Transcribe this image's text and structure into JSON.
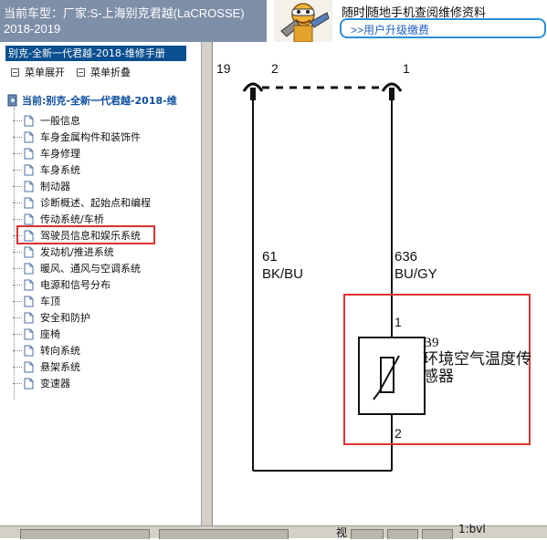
{
  "header": {
    "vehicle_title_line1": "当前车型：厂家:S-上海别克君越(LaCROSSE)",
    "vehicle_title_line2": "2018-2019"
  },
  "banner": {
    "line1_a": "随时",
    "line1_b": "随地手机查阅维修资料",
    "upgrade_link": ">>用户升级缴费"
  },
  "sidebar": {
    "manual_title": "别克-全新一代君越-2018-维修手册",
    "expand_menu": "菜单展开",
    "collapse_menu": "菜单折叠",
    "root_label": "当前:别克-全新一代君越-2018-维",
    "items": [
      {
        "label": "一般信息"
      },
      {
        "label": "车身金属构件和装饰件"
      },
      {
        "label": "车身修理"
      },
      {
        "label": "车身系统"
      },
      {
        "label": "制动器"
      },
      {
        "label": "诊断概述、起始点和编程"
      },
      {
        "label": "传动系统/车桥"
      },
      {
        "label": "驾驶员信息和娱乐系统"
      },
      {
        "label": "发动机/推进系统"
      },
      {
        "label": "暖风、通风与空调系统"
      },
      {
        "label": "电源和信号分布"
      },
      {
        "label": "车顶"
      },
      {
        "label": "安全和防护"
      },
      {
        "label": "座椅"
      },
      {
        "label": "转向系统"
      },
      {
        "label": "悬架系统"
      },
      {
        "label": "变速器"
      }
    ],
    "selected_index": 7
  },
  "diagram": {
    "pin_19": "19",
    "pin_2_top": "2",
    "pin_1_top": "1",
    "left_wire_num": "61",
    "left_wire_color": "BK/BU",
    "right_wire_num": "636",
    "right_wire_color": "BU/GY",
    "sensor_pin_1": "1",
    "sensor_pin_2": "2",
    "sensor_code": "B9",
    "sensor_name": "环境空气温度传感器"
  },
  "bottom_bar": {
    "view_label": "视",
    "scale_label": "1:bvl"
  },
  "colors": {
    "header_bg": "#7e8fa8",
    "selected_title_bg": "#0a4f8f",
    "highlight": "#e0312f",
    "banner_border": "#2c8ed8",
    "link": "#1f5fc4"
  },
  "icons": {
    "root": "book-globe-icon",
    "tree_item": "document-icon",
    "menu": "menu-square-icon",
    "mascot": "mascot-icon"
  }
}
